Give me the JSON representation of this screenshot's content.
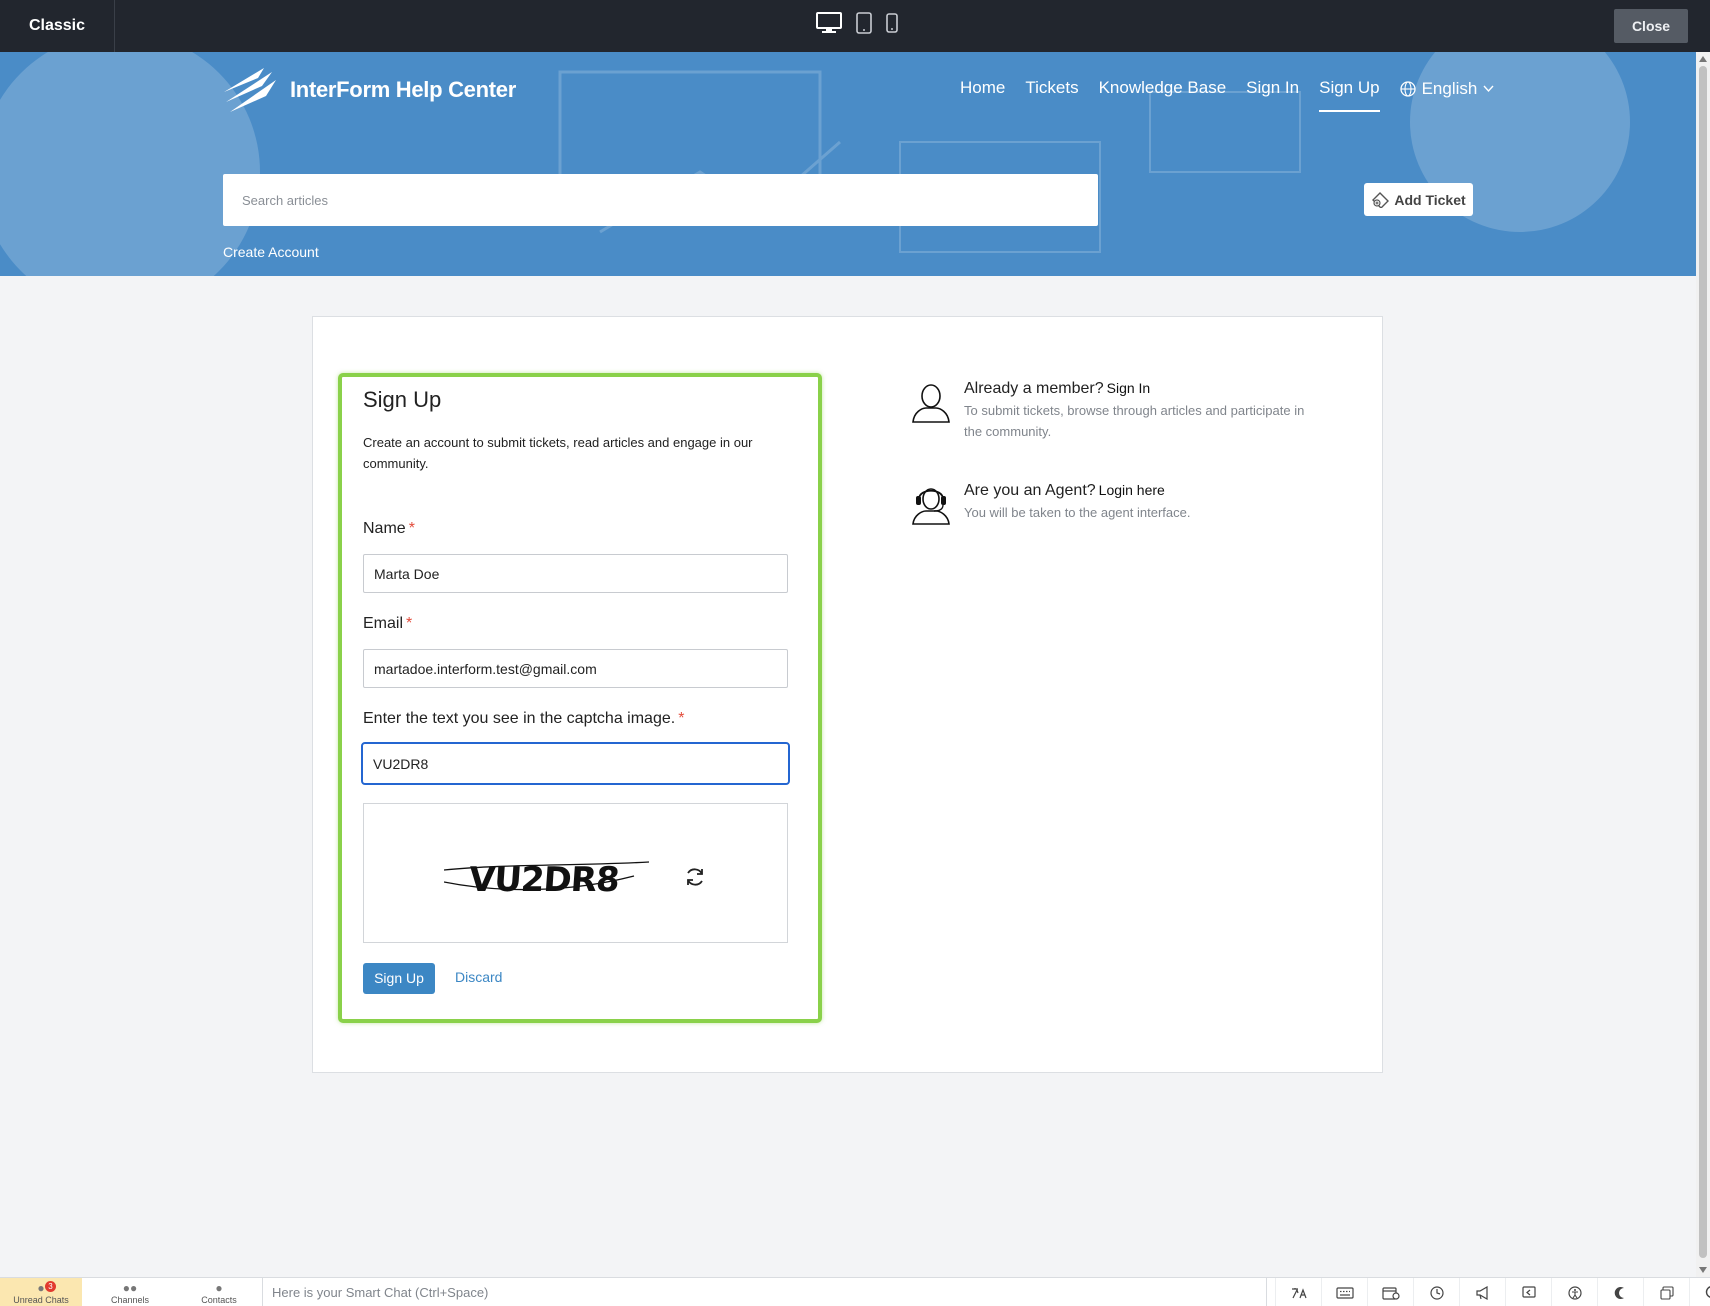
{
  "topbar": {
    "mode_label": "Classic",
    "close_label": "Close",
    "devices": [
      "desktop-icon",
      "tablet-icon",
      "mobile-icon"
    ]
  },
  "brand": {
    "name": "InterForm Help Center",
    "logo": "interform-logo"
  },
  "nav": {
    "items": [
      {
        "label": "Home"
      },
      {
        "label": "Tickets"
      },
      {
        "label": "Knowledge Base"
      },
      {
        "label": "Sign In"
      },
      {
        "label": "Sign Up"
      }
    ],
    "active_index": 4,
    "language": "English"
  },
  "search": {
    "placeholder": "Search articles"
  },
  "add_ticket_label": "Add Ticket",
  "breadcrumb": "Create Account",
  "signup": {
    "title": "Sign Up",
    "description": "Create an account to submit tickets, read articles and engage in our community.",
    "name_label": "Name",
    "name_value": "Marta Doe",
    "email_label": "Email",
    "email_value": "martadoe.interform.test@gmail.com",
    "captcha_label": "Enter the text you see in the captcha image.",
    "captcha_value": "VU2DR8",
    "captcha_image_text": "VU2DR8",
    "required_mark": "*",
    "submit_label": "Sign Up",
    "discard_label": "Discard"
  },
  "side": {
    "member_title": "Already a member?",
    "member_link": "Sign In",
    "member_desc": "To submit tickets, browse through articles and participate in the community.",
    "agent_title": "Are you an Agent?",
    "agent_link": "Login here",
    "agent_desc": "You will be taken to the agent interface."
  },
  "bottombar": {
    "tabs": [
      {
        "label": "Unread Chats",
        "badge": "3"
      },
      {
        "label": "Channels"
      },
      {
        "label": "Contacts"
      }
    ],
    "smartchat_placeholder": "Here is your Smart Chat (Ctrl+Space)",
    "tools": [
      "translate-icon",
      "keyboard-icon",
      "schedule-icon",
      "clock-icon",
      "announce-icon",
      "reply-icon",
      "accessibility-icon",
      "dark-mode-icon",
      "chats-icon",
      "search-icon"
    ]
  },
  "colors": {
    "accent": "#3c87c4",
    "hero": "#4a8cc7",
    "highlight": "#8ad14a",
    "focus": "#2466d1",
    "required": "#e24b3b"
  }
}
